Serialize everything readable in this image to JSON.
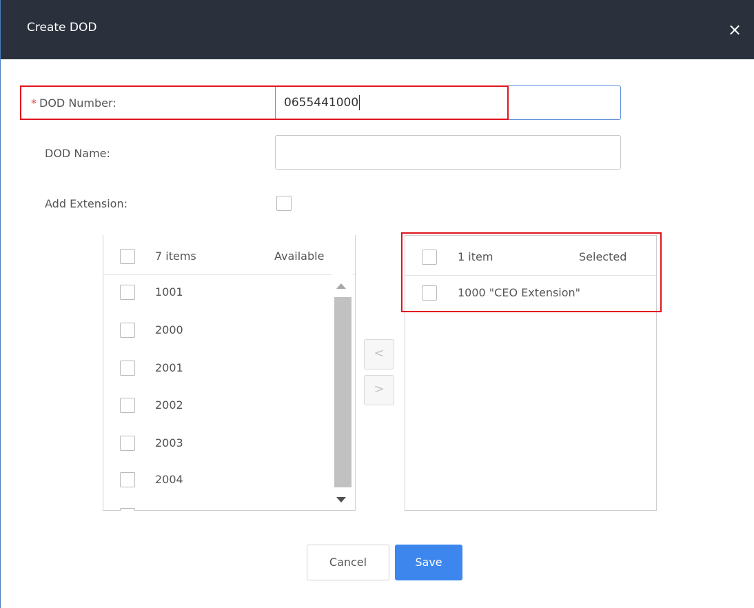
{
  "dialog": {
    "title": "Create DOD",
    "close_glyph": "×"
  },
  "form": {
    "dod_number_label": "DOD Number:",
    "dod_number_required": "*",
    "dod_number_value": "0655441000",
    "dod_name_label": "DOD Name:",
    "dod_name_value": "",
    "add_extension_label": "Add Extension:",
    "add_extension_checked": false
  },
  "transfer": {
    "available": {
      "count_label": "7 items",
      "title": "Available",
      "items": [
        "1001",
        "2000",
        "2001",
        "2002",
        "2003",
        "2004"
      ]
    },
    "selected": {
      "count_label": "1 item",
      "title": "Selected",
      "items": [
        "1000 \"CEO Extension\""
      ]
    },
    "move_left_glyph": "<",
    "move_right_glyph": ">"
  },
  "buttons": {
    "cancel": "Cancel",
    "save": "Save"
  },
  "colors": {
    "title_bar": "#2b313c",
    "primary": "#3d86ee",
    "highlight": "#e0141e",
    "required": "#e64545"
  },
  "icons": {
    "close": "close-icon",
    "scroll_up": "caret-up-icon",
    "scroll_down": "caret-down-icon"
  }
}
